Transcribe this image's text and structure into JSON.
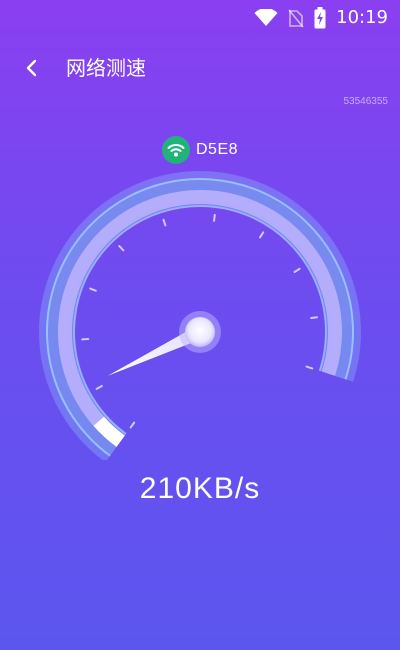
{
  "status_bar": {
    "time": "10:19",
    "icons": [
      "wifi-icon",
      "no-sim-icon",
      "battery-charging-icon"
    ]
  },
  "header": {
    "back_icon": "chevron-left-icon",
    "title": "网络测速"
  },
  "device_id": "53546355",
  "network": {
    "icon": "wifi-icon",
    "name": "D5E8",
    "badge_color": "#22b37d"
  },
  "gauge": {
    "level": 0.05,
    "tick_count": 11
  },
  "speed": {
    "value": "210KB/s"
  },
  "colors": {
    "background_top": "#8a3ff0",
    "background_bottom": "#5c56ef",
    "accent": "#ffffff"
  }
}
